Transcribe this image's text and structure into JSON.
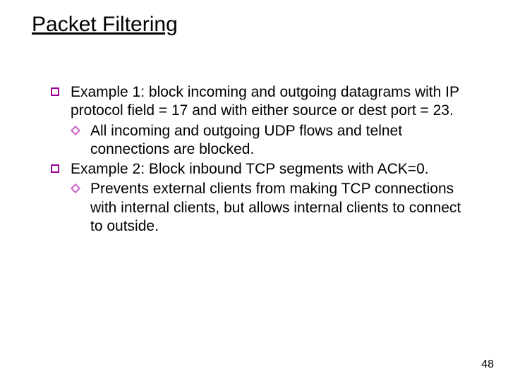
{
  "title": "Packet Filtering",
  "bullets": {
    "b1": "Example 1: block incoming and outgoing datagrams with IP protocol field = 17 and with either source or dest port = 23.",
    "b1s1": "All incoming and outgoing UDP flows and telnet connections are blocked.",
    "b2": "Example 2: Block inbound TCP segments with ACK=0.",
    "b2s1": "Prevents external clients from making TCP connections with internal clients, but allows internal clients to connect to outside."
  },
  "page_number": "48"
}
